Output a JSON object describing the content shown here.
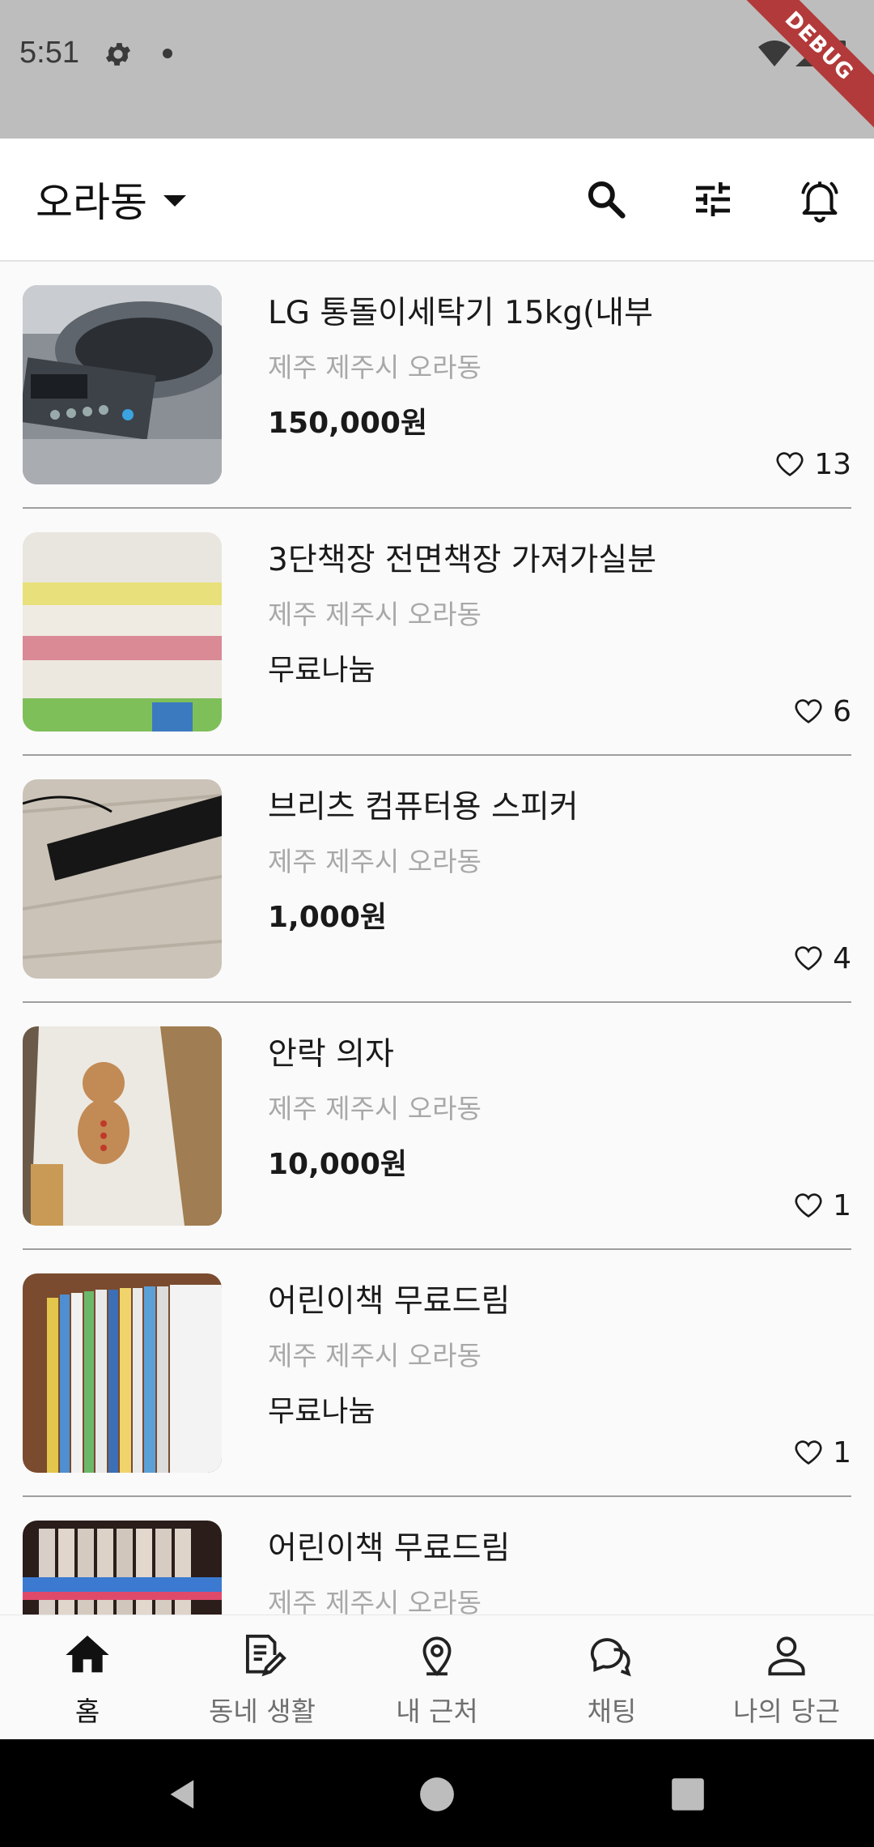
{
  "status_bar": {
    "time": "5:51",
    "debug_label": "DEBUG"
  },
  "app_bar": {
    "location": "오라동",
    "icons": [
      "search-icon",
      "tune-icon",
      "bell-icon"
    ]
  },
  "listings": [
    {
      "title": "LG 통돌이세탁기 15kg(내부",
      "location": "제주 제주시 오라동",
      "price": "150,000원",
      "likes": "13"
    },
    {
      "title": "3단책장 전면책장 가져가실분",
      "location": "제주 제주시 오라동",
      "price": "무료나눔",
      "likes": "6"
    },
    {
      "title": "브리츠 컴퓨터용 스피커",
      "location": "제주 제주시 오라동",
      "price": "1,000원",
      "likes": "4"
    },
    {
      "title": "안락 의자",
      "location": "제주 제주시 오라동",
      "price": "10,000원",
      "likes": "1"
    },
    {
      "title": "어린이책 무료드림",
      "location": "제주 제주시 오라동",
      "price": "무료나눔",
      "likes": "1"
    },
    {
      "title": "어린이책 무료드림",
      "location": "제주 제주시 오라동",
      "price": "",
      "likes": ""
    }
  ],
  "bottom_nav": {
    "items": [
      {
        "label": "홈",
        "icon": "home-icon",
        "active": true
      },
      {
        "label": "동네 생활",
        "icon": "edit-note-icon",
        "active": false
      },
      {
        "label": "내 근처",
        "icon": "location-pin-icon",
        "active": false
      },
      {
        "label": "채팅",
        "icon": "chat-icon",
        "active": false
      },
      {
        "label": "나의 당근",
        "icon": "person-icon",
        "active": false
      }
    ]
  },
  "colors": {
    "status_bar": "#bdbdbd",
    "debug_banner": "#b23a3a",
    "divider": "#9e9e9e",
    "muted_text": "#a8a8a8",
    "background": "#fafafa"
  }
}
